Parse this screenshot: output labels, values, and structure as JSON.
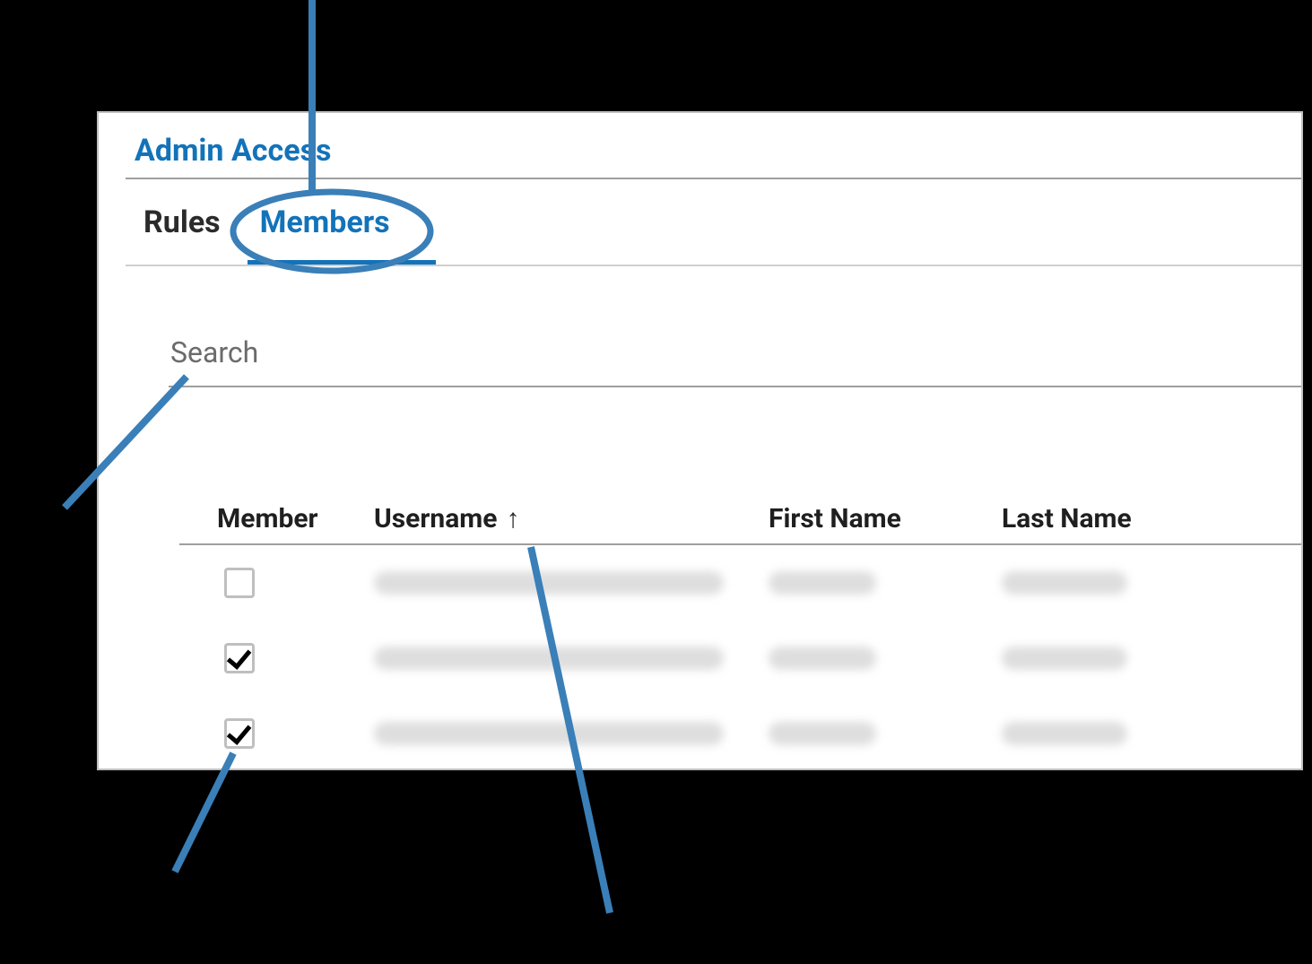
{
  "panel": {
    "title": "Admin Access"
  },
  "tabs": {
    "rules": "Rules",
    "members": "Members",
    "active": "members"
  },
  "search": {
    "label": "Search",
    "value": ""
  },
  "table": {
    "columns": {
      "member": "Member",
      "username": "Username",
      "first_name": "First Name",
      "last_name": "Last Name"
    },
    "sort": {
      "column": "username",
      "direction": "asc",
      "icon": "arrow-up"
    },
    "rows": [
      {
        "member": false,
        "username": "",
        "first_name": "",
        "last_name": ""
      },
      {
        "member": true,
        "username": "",
        "first_name": "",
        "last_name": ""
      },
      {
        "member": true,
        "username": "",
        "first_name": "",
        "last_name": ""
      }
    ]
  },
  "annotations": {
    "callout_members_tab": true,
    "callout_search": true,
    "callout_sort_arrow": true,
    "callout_checkbox": true
  },
  "colors": {
    "accent": "#1373b9",
    "annotation": "#3a7fb8",
    "text": "#2b2b2b",
    "muted": "#6b6b6b",
    "rule": "#9e9e9e"
  }
}
